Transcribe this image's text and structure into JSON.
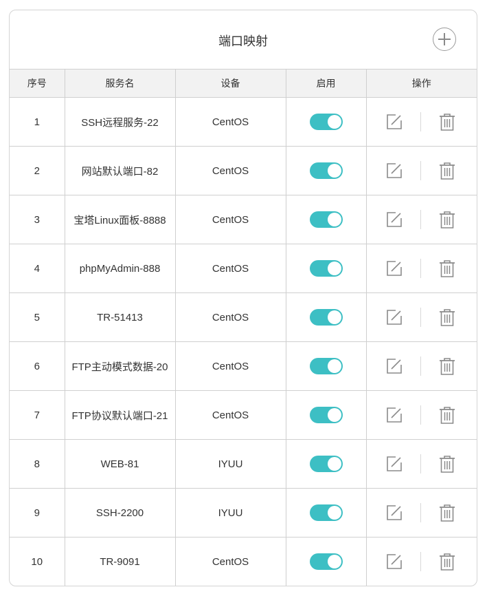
{
  "header": {
    "title": "端口映射",
    "add_icon": "plus-icon"
  },
  "colors": {
    "toggle_on": "#3dbfc4",
    "icon_gray": "#8a8a8a"
  },
  "table": {
    "columns": [
      "序号",
      "服务名",
      "设备",
      "启用",
      "操作"
    ],
    "rows": [
      {
        "index": "1",
        "service": "SSH远程服务-22",
        "device": "CentOS",
        "enabled": true
      },
      {
        "index": "2",
        "service": "网站默认端口-82",
        "device": "CentOS",
        "enabled": true
      },
      {
        "index": "3",
        "service": "宝塔Linux面板-8888",
        "device": "CentOS",
        "enabled": true
      },
      {
        "index": "4",
        "service": "phpMyAdmin-888",
        "device": "CentOS",
        "enabled": true
      },
      {
        "index": "5",
        "service": "TR-51413",
        "device": "CentOS",
        "enabled": true
      },
      {
        "index": "6",
        "service": "FTP主动模式数据-20",
        "device": "CentOS",
        "enabled": true
      },
      {
        "index": "7",
        "service": "FTP协议默认端口-21",
        "device": "CentOS",
        "enabled": true
      },
      {
        "index": "8",
        "service": "WEB-81",
        "device": "IYUU",
        "enabled": true
      },
      {
        "index": "9",
        "service": "SSH-2200",
        "device": "IYUU",
        "enabled": true
      },
      {
        "index": "10",
        "service": "TR-9091",
        "device": "CentOS",
        "enabled": true
      }
    ],
    "row_icons": {
      "edit": "edit-icon",
      "delete": "trash-icon"
    }
  }
}
